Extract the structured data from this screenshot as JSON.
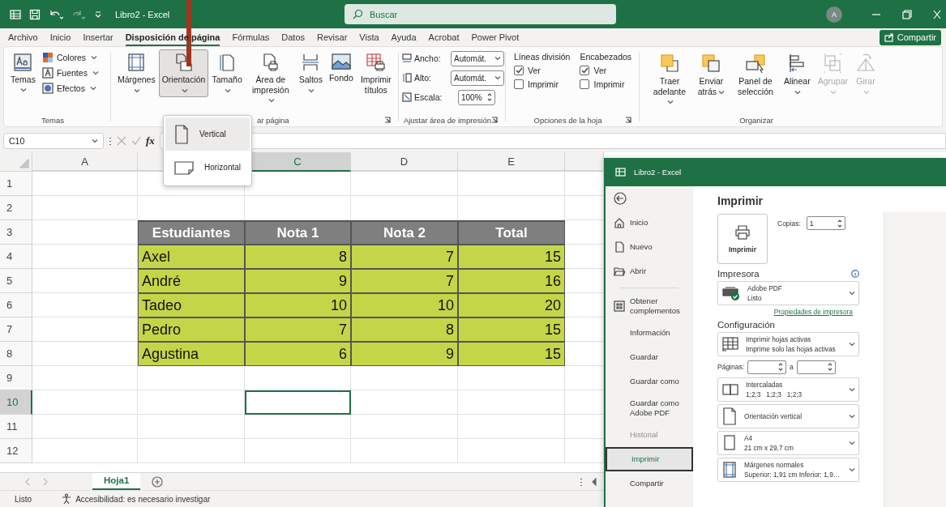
{
  "title_bar": {
    "file_name": "Libro2 - Excel",
    "search_placeholder": "Buscar",
    "avatar": "A"
  },
  "menu_tabs": [
    {
      "label": "Archivo",
      "selected": false
    },
    {
      "label": "Inicio",
      "selected": false
    },
    {
      "label": "Insertar",
      "selected": false
    },
    {
      "label": "Disposición de página",
      "selected": true
    },
    {
      "label": "Fórmulas",
      "selected": false
    },
    {
      "label": "Datos",
      "selected": false
    },
    {
      "label": "Revisar",
      "selected": false
    },
    {
      "label": "Vista",
      "selected": false
    },
    {
      "label": "Ayuda",
      "selected": false
    },
    {
      "label": "Acrobat",
      "selected": false
    },
    {
      "label": "Power Pivot",
      "selected": false
    }
  ],
  "share_button": "Compartir",
  "ribbon": {
    "themes": {
      "label": "Temas",
      "button": "Temas",
      "items": [
        "Colores",
        "Fuentes",
        "Efectos"
      ]
    },
    "page_setup": {
      "label": "ar página",
      "buttons": [
        {
          "label": "Márgenes",
          "pressed": false,
          "has_menu": true
        },
        {
          "label": "Orientación",
          "pressed": true,
          "has_menu": true
        },
        {
          "label": "Tamaño",
          "pressed": false,
          "has_menu": true
        },
        {
          "label": "Área de impresión",
          "pressed": false,
          "has_menu": true
        },
        {
          "label": "Saltos",
          "pressed": false,
          "has_menu": true
        },
        {
          "label": "Fondo",
          "pressed": false,
          "has_menu": false
        },
        {
          "label": "Imprimir títulos",
          "pressed": false,
          "has_menu": false
        }
      ]
    },
    "scale_to_fit": {
      "label": "Ajustar área de impresión",
      "fields": [
        {
          "label": "Ancho:",
          "value": "Automát.",
          "kind": "select"
        },
        {
          "label": "Alto:",
          "value": "Automát.",
          "kind": "select"
        },
        {
          "label": "Escala:",
          "value": "100%",
          "kind": "spin"
        }
      ]
    },
    "sheet_options": {
      "label": "Opciones de la hoja",
      "columns": [
        {
          "heading": "Líneas división",
          "options": [
            {
              "label": "Ver",
              "checked": true
            },
            {
              "label": "Imprimir",
              "checked": false
            }
          ]
        },
        {
          "heading": "Encabezados",
          "options": [
            {
              "label": "Ver",
              "checked": true
            },
            {
              "label": "Imprimir",
              "checked": false
            }
          ]
        }
      ]
    },
    "arrange": {
      "label": "Organizar",
      "buttons": [
        {
          "label": "Traer adelante",
          "disabled": false,
          "has_menu": true
        },
        {
          "label": "Enviar atrás",
          "disabled": false,
          "has_menu": true
        },
        {
          "label": "Panel de selección",
          "disabled": false,
          "has_menu": false
        },
        {
          "label": "Alinear",
          "disabled": false,
          "has_menu": true
        },
        {
          "label": "Agrupar",
          "disabled": true,
          "has_menu": true
        },
        {
          "label": "Girar",
          "disabled": true,
          "has_menu": true
        }
      ]
    }
  },
  "orientation_menu": [
    {
      "label": "Vertical",
      "selected": true
    },
    {
      "label": "Horizontal",
      "selected": false
    }
  ],
  "formula_bar": {
    "name_box": "C10",
    "function_label": "fx"
  },
  "sheet": {
    "columns": [
      {
        "label": "A",
        "selected": false
      },
      {
        "selected": false
      },
      {
        "label": "C",
        "selected": true
      },
      {
        "label": "D",
        "selected": false
      },
      {
        "label": "E",
        "selected": false
      }
    ],
    "rows": [
      {
        "number": "1",
        "kind": "blank",
        "selected": false
      },
      {
        "number": "2",
        "kind": "blank",
        "selected": false
      },
      {
        "number": "3",
        "kind": "header",
        "selected": false,
        "cells": [
          "Estudiantes",
          "Nota 1",
          "Nota 2",
          "Total"
        ]
      },
      {
        "number": "4",
        "kind": "data",
        "selected": false,
        "cells": [
          "Axel",
          "8",
          "7",
          "15"
        ]
      },
      {
        "number": "5",
        "kind": "data",
        "selected": false,
        "cells": [
          "André",
          "9",
          "7",
          "16"
        ]
      },
      {
        "number": "6",
        "kind": "data",
        "selected": false,
        "cells": [
          "Tadeo",
          "10",
          "10",
          "20"
        ]
      },
      {
        "number": "7",
        "kind": "data",
        "selected": false,
        "cells": [
          "Pedro",
          "7",
          "8",
          "15"
        ]
      },
      {
        "number": "8",
        "kind": "data",
        "selected": false,
        "cells": [
          "Agustina",
          "6",
          "9",
          "15"
        ]
      },
      {
        "number": "9",
        "kind": "blank",
        "selected": false
      },
      {
        "number": "10",
        "kind": "blank",
        "selected": true
      },
      {
        "number": "11",
        "kind": "blank",
        "selected": false
      },
      {
        "number": "12",
        "kind": "blank",
        "selected": false
      }
    ]
  },
  "sheet_tabs": [
    {
      "label": "Hoja1",
      "selected": true
    }
  ],
  "status_bar": {
    "ready": "Listo",
    "accessibility": "Accesibilidad: es necesario investigar"
  },
  "print_window": {
    "title": "Libro2 - Excel",
    "nav_top": [
      {
        "label": "Inicio",
        "selected": false,
        "disabled": false
      },
      {
        "label": "Nuevo",
        "selected": false,
        "disabled": false
      },
      {
        "label": "Abrir",
        "selected": false,
        "disabled": false
      }
    ],
    "nav_bottom": [
      {
        "label": "Obtener complementos",
        "selected": false,
        "disabled": false
      },
      {
        "label": "Información",
        "selected": false,
        "disabled": false
      },
      {
        "label": "Guardar",
        "selected": false,
        "disabled": false
      },
      {
        "label": "Guardar como",
        "selected": false,
        "disabled": false
      },
      {
        "label": "Guardar como Adobe PDF",
        "selected": false,
        "disabled": false
      },
      {
        "label": "Historial",
        "selected": false,
        "disabled": true
      },
      {
        "label": "Imprimir",
        "selected": true,
        "disabled": false
      },
      {
        "label": "Compartir",
        "selected": false,
        "disabled": false
      }
    ],
    "heading": "Imprimir",
    "print_button": "Imprimir",
    "copies_label": "Copias:",
    "copies": "1",
    "printer_heading": "Impresora",
    "printer": {
      "name": "Adobe PDF",
      "status": "Listo"
    },
    "printer_properties": "Propiedades de impresora",
    "settings_heading": "Configuración",
    "settings": [
      {
        "kind": "dropdown",
        "title": "Imprimir hojas activas",
        "subtitle": "Imprime solo las hojas activas"
      },
      {
        "kind": "pages",
        "label": "Páginas:",
        "separator": "a"
      },
      {
        "kind": "dropdown",
        "title": "Intercaladas",
        "subtitle": "1;2;3   1;2;3   1;2;3"
      },
      {
        "kind": "dropdown",
        "title": "Orientación vertical"
      },
      {
        "kind": "dropdown",
        "title": "A4",
        "subtitle": "21 cm x 29,7 cm"
      },
      {
        "kind": "dropdown",
        "title": "Márgenes normales",
        "subtitle": "Superior: 1,91 cm Inferior: 1,9…"
      }
    ]
  }
}
